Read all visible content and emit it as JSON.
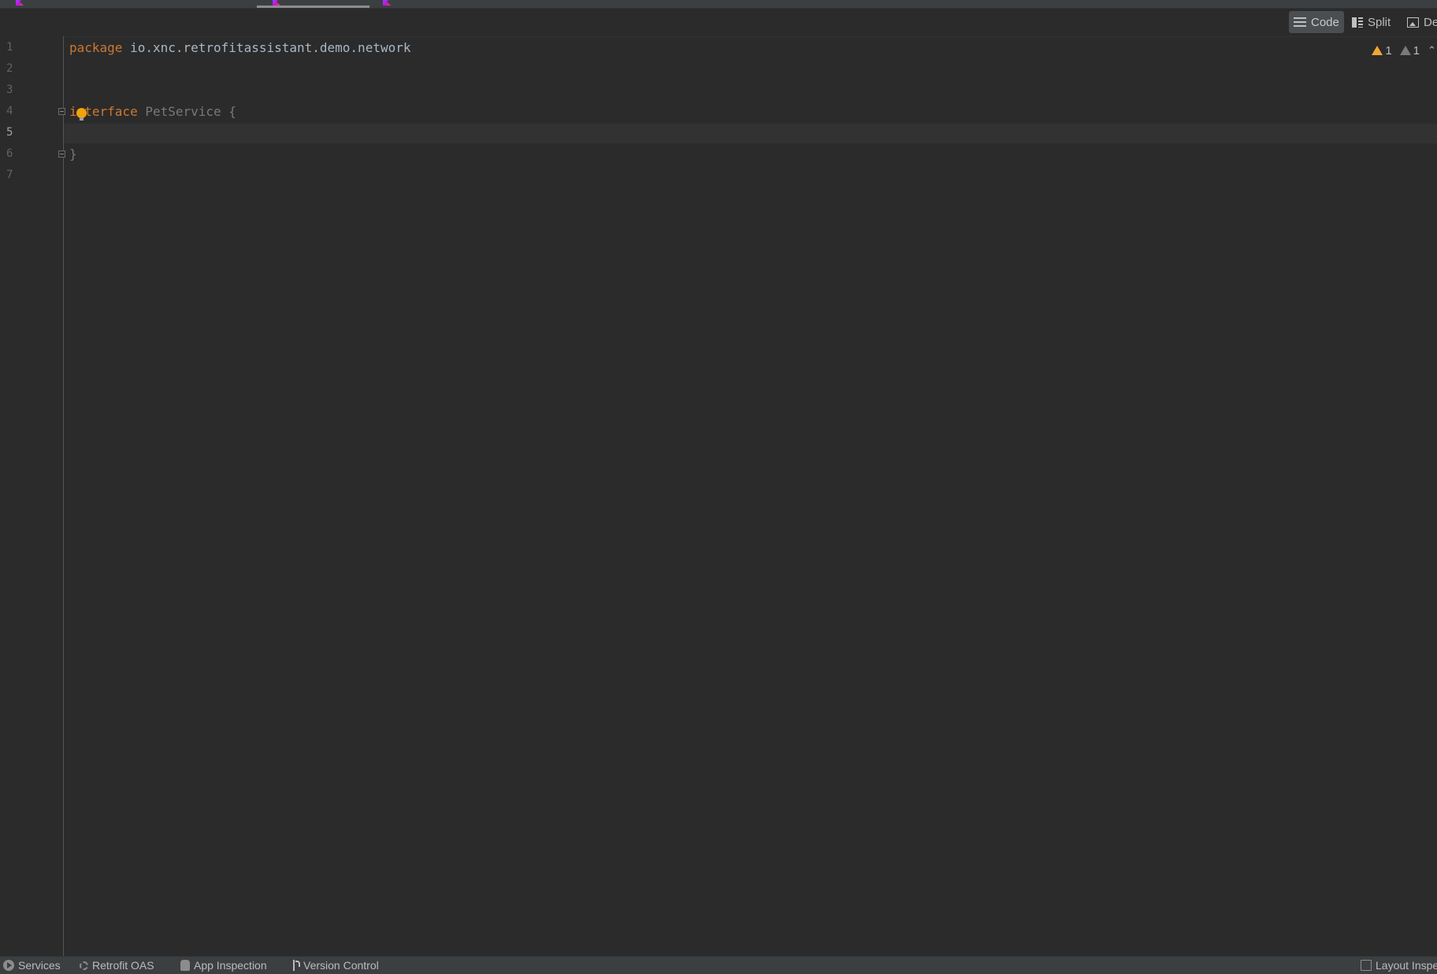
{
  "tabs": [
    {
      "label": "",
      "active": false
    },
    {
      "label": "",
      "active": true
    },
    {
      "label": "",
      "active": false
    }
  ],
  "toolbar": {
    "modes": [
      {
        "label": "Code",
        "icon": "lines-icon",
        "active": true
      },
      {
        "label": "Split",
        "icon": "split-icon",
        "active": false
      },
      {
        "label": "De",
        "icon": "image-icon",
        "active": false
      }
    ]
  },
  "inspections": {
    "warnings": "1",
    "weak_warnings": "1"
  },
  "editor": {
    "line_numbers": [
      "1",
      "2",
      "3",
      "4",
      "5",
      "6",
      "7"
    ],
    "current_line": 5,
    "lines": {
      "l1_keyword": "package",
      "l1_rest": " io.xnc.retrofitassistant.demo.network",
      "l4_keyword": "interface",
      "l4_rest": " PetService {",
      "l6": "}"
    }
  },
  "bottom_tools": [
    {
      "label": "Services",
      "icon": "services-icon"
    },
    {
      "label": "Retrofit OAS",
      "icon": "retrofit-oas-icon"
    },
    {
      "label": "App Inspection",
      "icon": "app-inspection-icon"
    },
    {
      "label": "Version Control",
      "icon": "version-control-icon"
    },
    {
      "label": "Layout Inspe",
      "icon": "layout-inspector-icon"
    }
  ],
  "colors": {
    "background": "#2b2b2b",
    "keyword": "#cc7832",
    "text": "#a9b7c6",
    "warning": "#f0a732"
  }
}
